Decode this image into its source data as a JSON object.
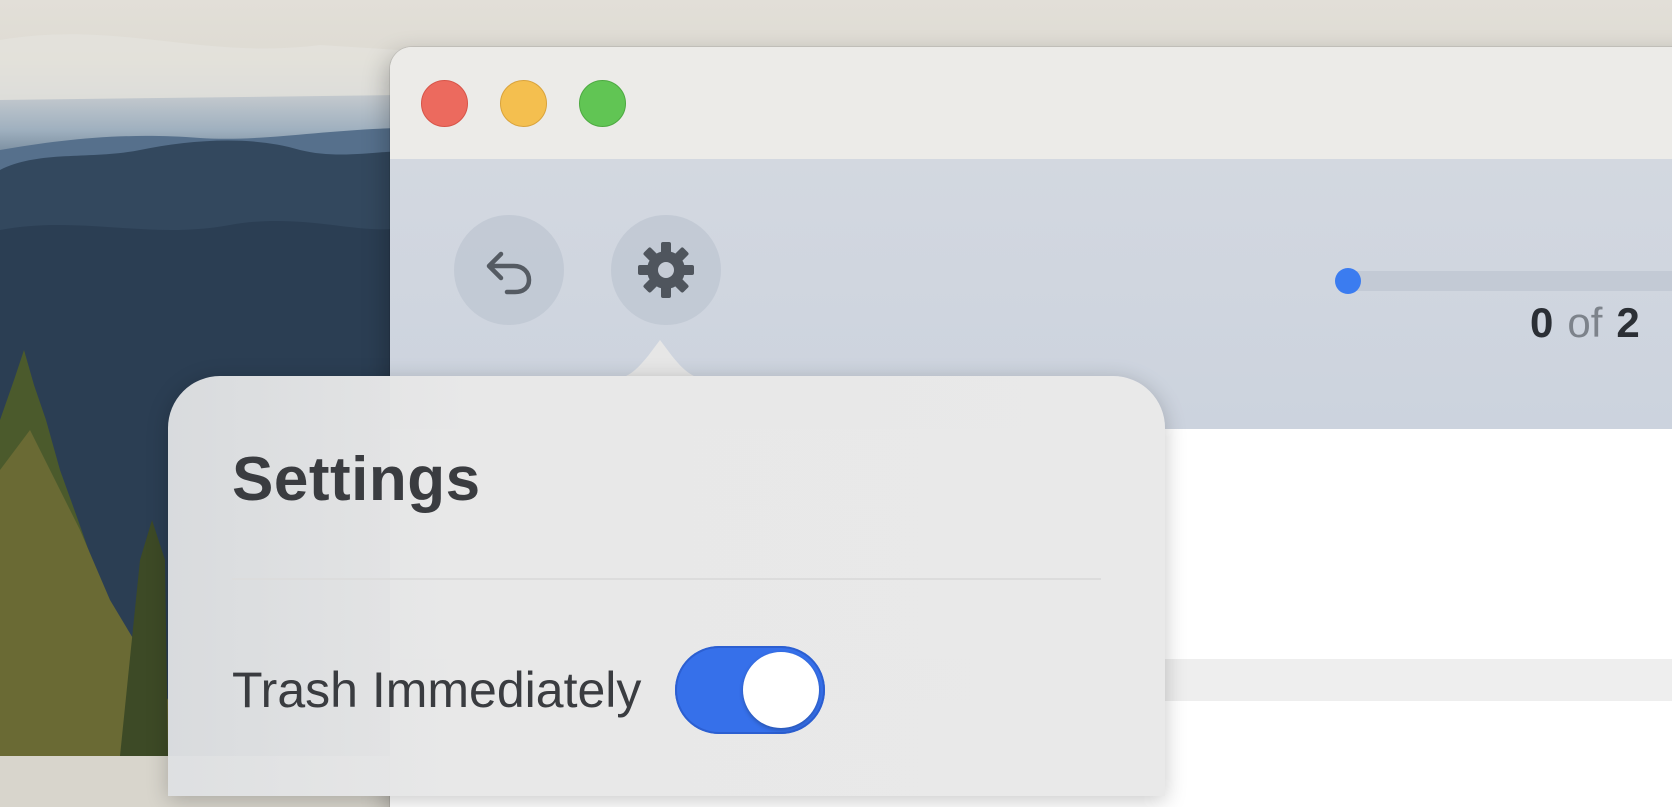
{
  "window": {
    "controls": [
      "close",
      "minimize",
      "zoom"
    ]
  },
  "toolbar": {
    "undo_icon": "undo-arrow-icon",
    "settings_icon": "gear-icon",
    "progress": {
      "current": "0",
      "of_label": "of",
      "total": "2",
      "fraction": 0
    },
    "accent_color": "#3b7cf0"
  },
  "settings_popover": {
    "title": "Settings",
    "options": [
      {
        "label": "Trash Immediately",
        "enabled": true
      }
    ],
    "toggle_color": "#3670ea"
  }
}
